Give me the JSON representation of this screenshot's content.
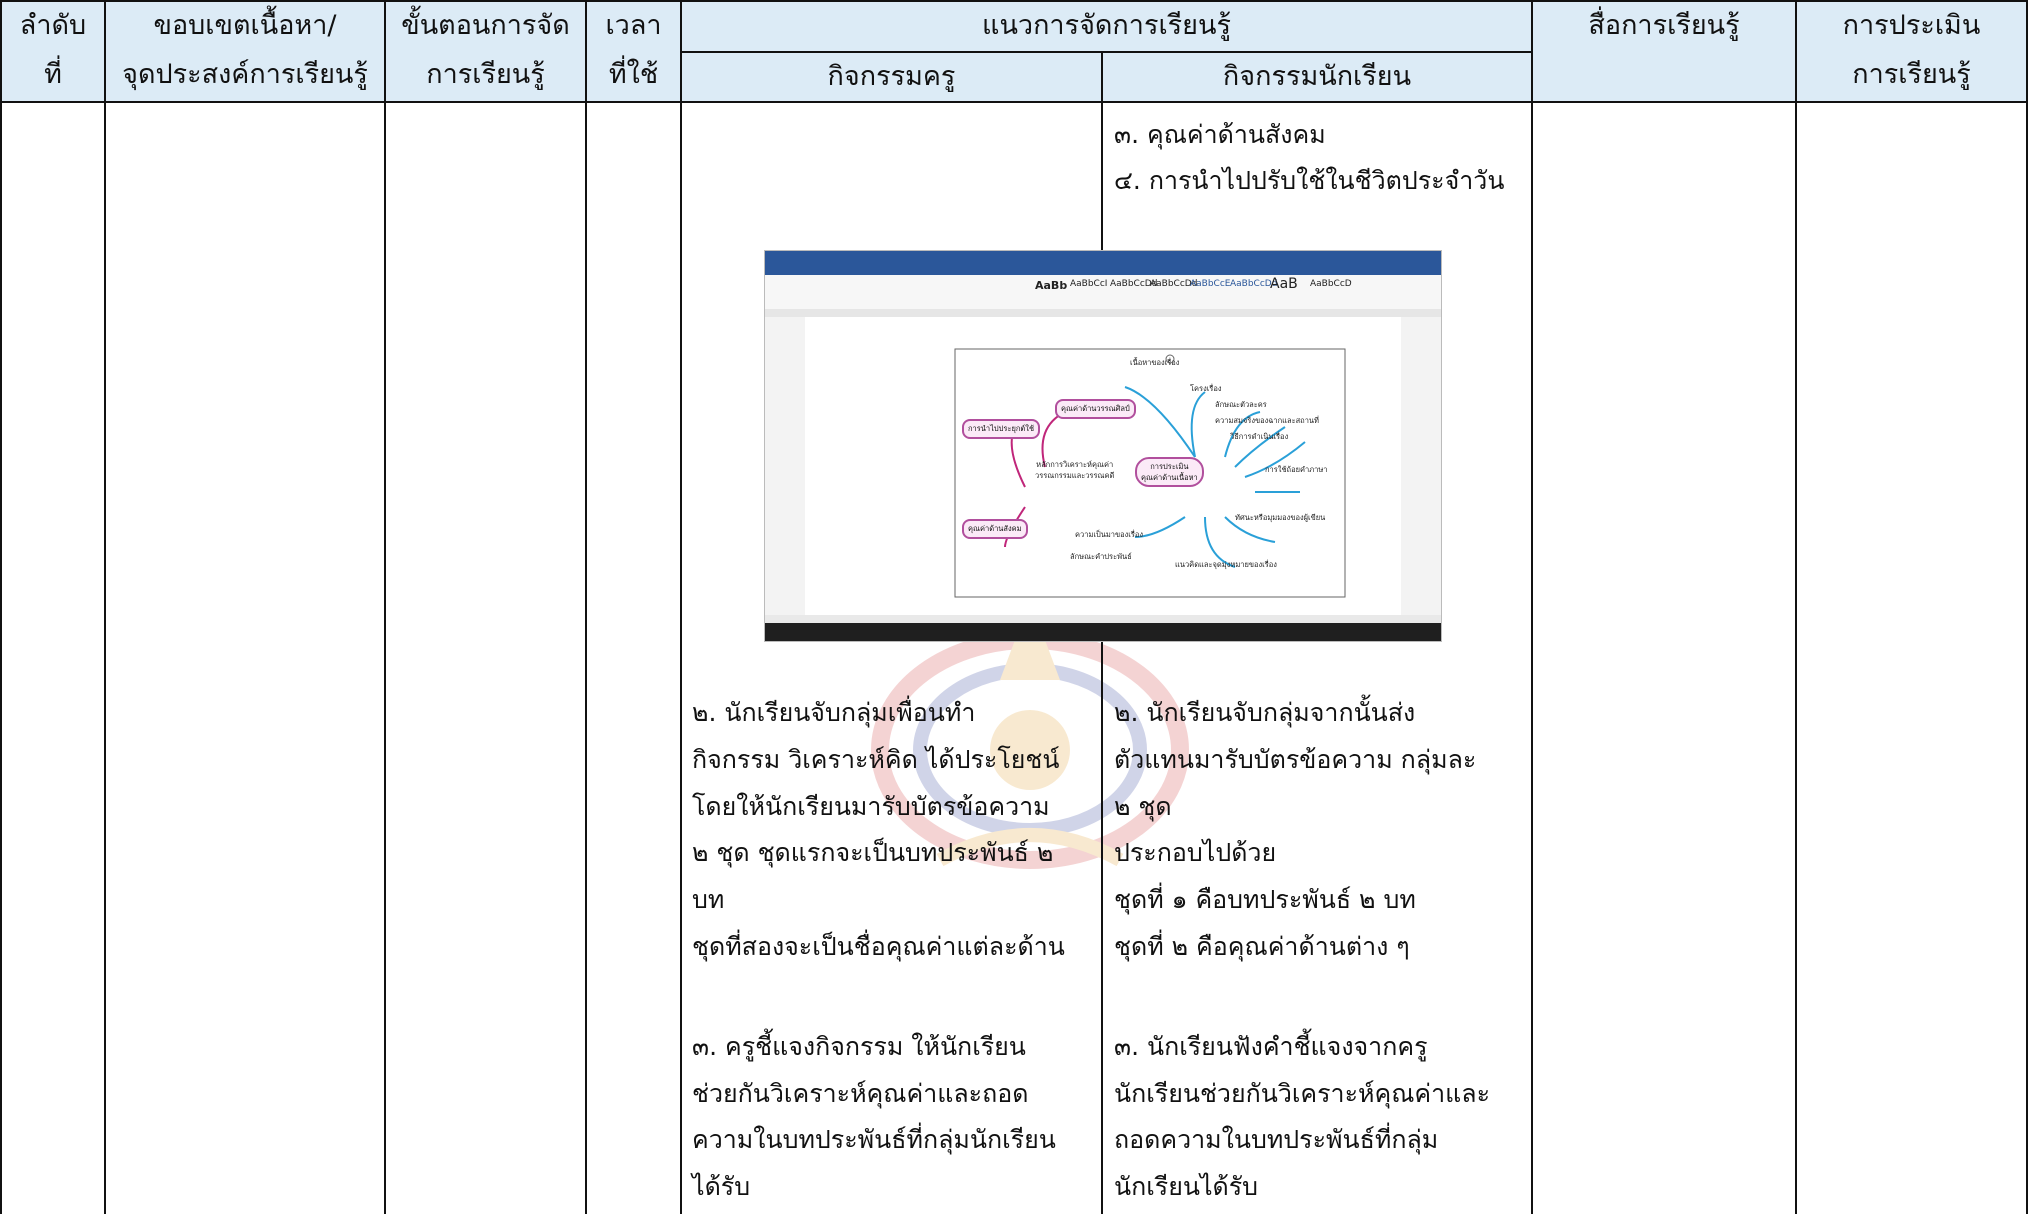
{
  "header": {
    "col1": [
      "ลำดับ",
      "ที่"
    ],
    "col2": [
      "ขอบเขตเนื้อหา/",
      "จุดประสงค์การเรียนรู้"
    ],
    "col3": [
      "ขั้นตอนการจัด",
      "การเรียนรู้"
    ],
    "col4": [
      "เวลา",
      "ที่ใช้"
    ],
    "group": "แนวการจัดการเรียนรู้",
    "teacher": "กิจกรรมครู",
    "student": "กิจกรรมนักเรียน",
    "media": "สื่อการเรียนรู้",
    "eval": [
      "การประเมิน",
      "การเรียนรู้"
    ]
  },
  "student_top": [
    "๓. คุณค่าด้านสังคม",
    "๔. การนำไปปรับใช้ในชีวิตประจำวัน"
  ],
  "teacher_step2": [
    "๒. นักเรียนจับกลุ่มเพื่อนทำ",
    "กิจกรรม วิเคราะห์คิด ได้ประโยชน์",
    "โดยให้นักเรียนมารับบัตรข้อความ",
    "๒ ชุด ชุดแรกจะเป็นบทประพันธ์ ๒",
    "บท",
    "ชุดที่สองจะเป็นชื่อคุณค่าแต่ละด้าน"
  ],
  "student_step2": [
    "๒. นักเรียนจับกลุ่มจากนั้นส่ง",
    "ตัวแทนมารับบัตรข้อความ กลุ่มละ",
    "๒ ชุด",
    "ประกอบไปด้วย",
    "ชุดที่ ๑ คือบทประพันธ์ ๒ บท",
    "ชุดที่ ๒ คือคุณค่าด้านต่าง ๆ"
  ],
  "teacher_step3": [
    "๓. ครูชี้แจงกิจกรรม ให้นักเรียน",
    "ช่วยกันวิเคราะห์คุณค่าและถอด",
    "ความในบทประพันธ์ที่กลุ่มนักเรียน",
    "ได้รับ"
  ],
  "student_step3": [
    "๓. นักเรียนฟังคำชี้แจงจากครู",
    "นักเรียนช่วยกันวิเคราะห์คุณค่าและ",
    "ถอดความในบทประพันธ์ที่กลุ่ม",
    "นักเรียนได้รับ"
  ],
  "screenshot": {
    "center": "การประเมิน\nคุณค่าด้านเนื้อหา",
    "left_center": "หลักการวิเคราะห์คุณค่า\nวรรณกรรมและวรรณคดี",
    "nodes_left": [
      "คุณค่าด้านวรรณศิลป์",
      "การนำไปประยุกต์ใช้",
      "คุณค่าด้านสังคม"
    ],
    "nodes_right": [
      "เนื้อหาของเรื่อง",
      "โครงเรื่อง",
      "ลักษณะตัวละคร",
      "ความสมจริงของฉากและสถานที่",
      "วิธีการดำเนินเรื่อง",
      "การใช้ถ้อยคำภาษา",
      "ทัศนะหรือมุมมองของผู้เขียน",
      "แนวคิดและจุดมุ่งหมายของเรื่อง",
      "ความเป็นมาของเรื่อง",
      "ลักษณะคำประพันธ์"
    ],
    "styles": [
      "AaBb",
      "AaBbCcI",
      "AaBbCcDd",
      "AaBbCcDd",
      "AaBbCcE",
      "AaBbCcDd",
      "AaB",
      "AaBbCcD"
    ]
  },
  "colors": {
    "header_bg": "#dcebf6",
    "word_blue": "#2b579a",
    "mindmap_pink": "#b14f9d"
  }
}
